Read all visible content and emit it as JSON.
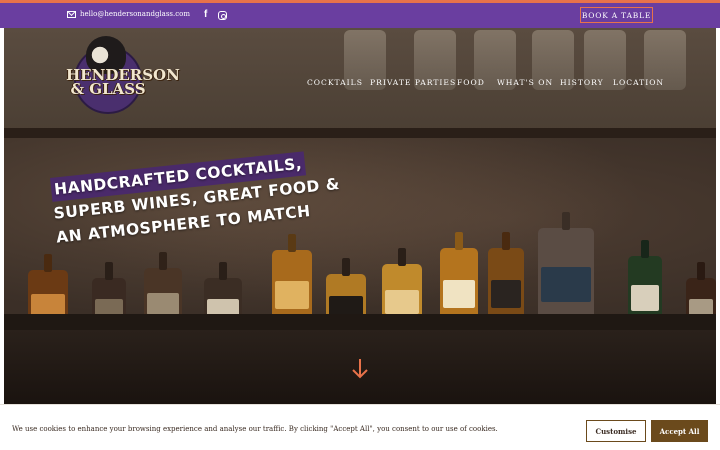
{
  "topbar": {
    "email": "hello@hendersonandglass.com",
    "email_icon": "mail-icon",
    "facebook_icon": "facebook-icon",
    "instagram_icon": "instagram-icon",
    "book_label": "BOOK A TABLE"
  },
  "logo": {
    "line1": "HENDERSON",
    "line2": "& GLASS"
  },
  "nav": {
    "items": [
      {
        "label": "COCKTAILS"
      },
      {
        "label": "PRIVATE PARTIES"
      },
      {
        "label": "FOOD"
      },
      {
        "label": "WHAT'S ON"
      },
      {
        "label": "HISTORY"
      },
      {
        "label": "LOCATION"
      }
    ]
  },
  "hero": {
    "headline": [
      "HANDCRAFTED COCKTAILS,",
      "SUPERB WINES, GREAT FOOD &",
      "AN ATMOSPHERE TO MATCH"
    ],
    "scroll_icon": "arrow-down-icon"
  },
  "cookie": {
    "text": "We use cookies to enhance your browsing experience and analyse our traffic. By clicking \"Accept All\", you consent to our use of cookies.",
    "customise_label": "Customise",
    "accept_label": "Accept All"
  },
  "colors": {
    "topbar": "#6a3ea0",
    "accent": "#e8724a",
    "button_brown": "#6b4a1c"
  }
}
